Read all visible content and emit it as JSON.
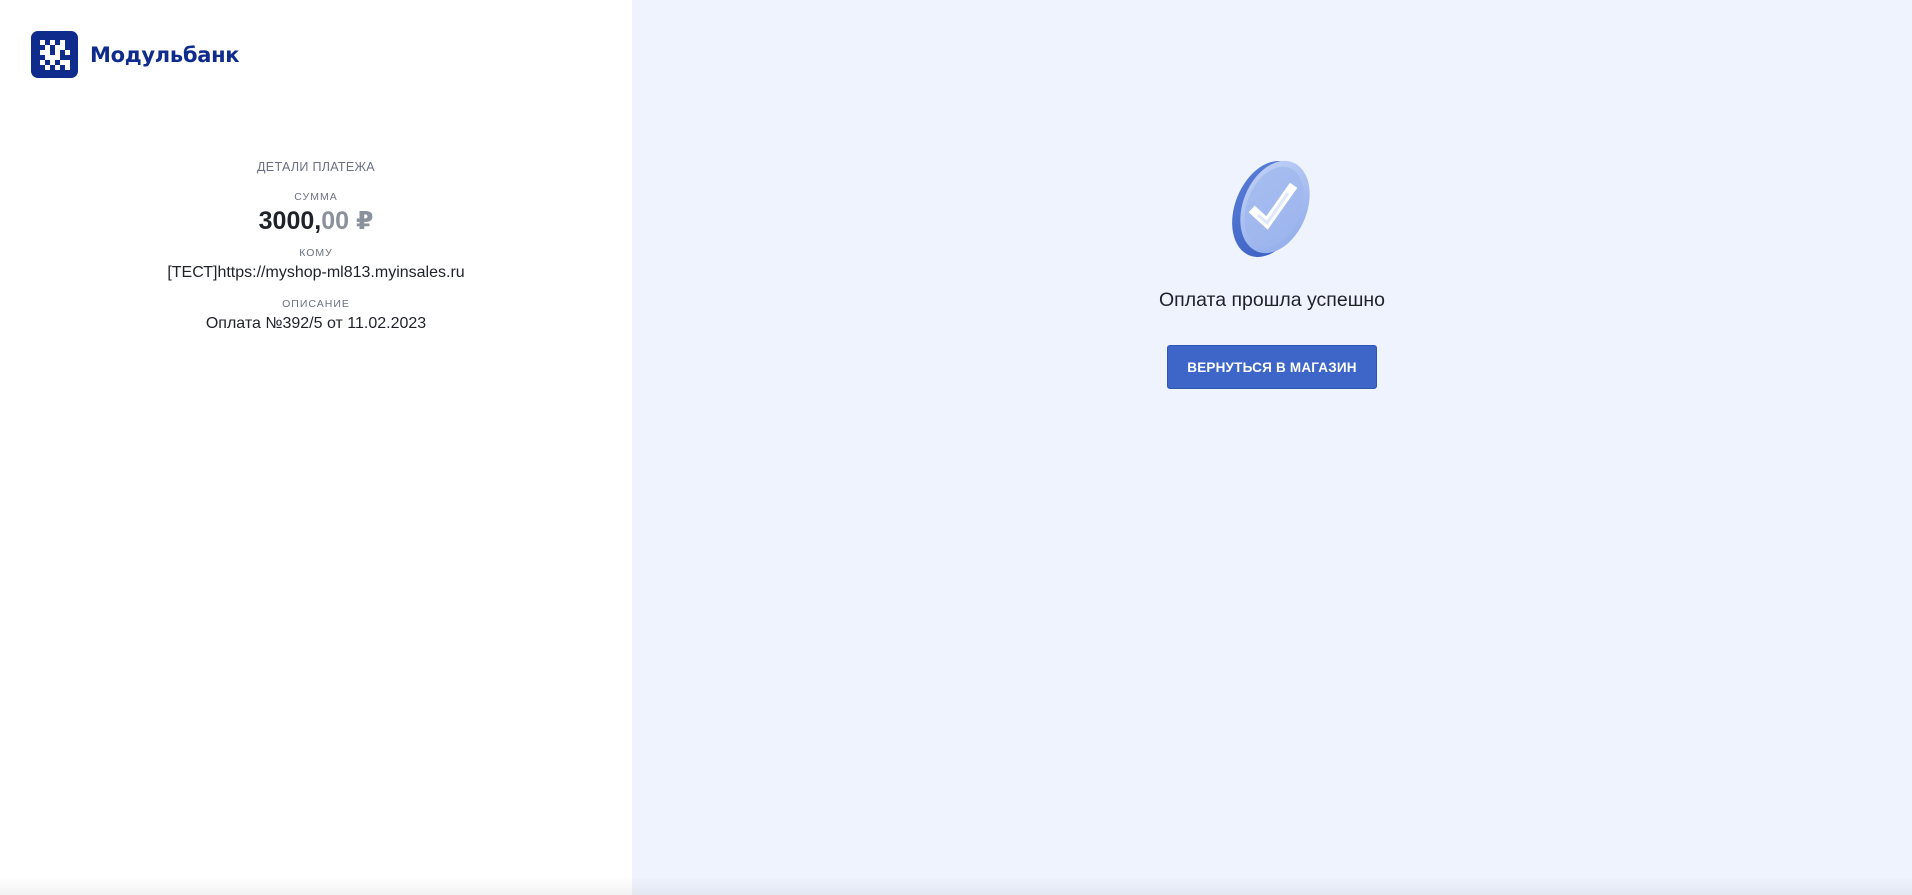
{
  "brand": {
    "name": "Модульбанк",
    "logo_icon": "modulbank-logo-icon",
    "color": "#0f2b8c"
  },
  "details": {
    "title": "ДЕТАЛИ ПЛАТЕЖА",
    "amount_label": "СУММА",
    "amount_major": "3000,",
    "amount_minor": "00 ₽",
    "recipient_label": "КОМУ",
    "recipient_value": "[ТЕСТ]https://myshop-ml813.myinsales.ru",
    "description_label": "ОПИСАНИЕ",
    "description_value": "Оплата №392/5 от 11.02.2023"
  },
  "result": {
    "icon": "success-check-icon",
    "message": "Оплата прошла успешно",
    "return_button_label": "ВЕРНУТЬСЯ В МАГАЗИН",
    "accent_color": "#3d66c8"
  },
  "colors": {
    "left_background": "#ffffff",
    "right_background": "#eef3fd",
    "muted_text": "#6b7180"
  }
}
